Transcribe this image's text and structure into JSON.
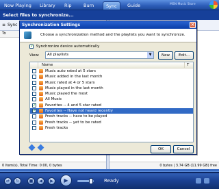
{
  "nav": {
    "tabs": [
      "Now Playing",
      "Library",
      "Rip",
      "Burn",
      "Sync",
      "Guide"
    ],
    "active_tab": "Sync",
    "brand": "MSN Music Store"
  },
  "page": {
    "header": "Select files to synchronize...",
    "left_toolbar_label": "Sync Li",
    "left_status": "0 Item(s), Total Time: 0:00, 0 bytes",
    "right_status": "0 bytes | 3.74 GB (11.99 GB) free"
  },
  "player": {
    "status": "Ready",
    "volume": 0.75
  },
  "dialog": {
    "title": "Synchronization Settings",
    "instruction": "Choose a synchronization method and the playlists you want to synchronize.",
    "auto_sync_label": "Synchronize device automatically",
    "auto_sync_checked": true,
    "view_label": "View:",
    "view_value": "All playlists",
    "new_button": "New",
    "edit_button": "Edit...",
    "column_name": "Name",
    "playlists": [
      {
        "name": "Music auto rated at 5 stars",
        "checked": false,
        "selected": false
      },
      {
        "name": "Music added in the last month",
        "checked": false,
        "selected": false
      },
      {
        "name": "Music rated at 4 or 5 stars",
        "checked": false,
        "selected": false
      },
      {
        "name": "Music played in the last month",
        "checked": false,
        "selected": false
      },
      {
        "name": "Music played the most",
        "checked": false,
        "selected": false
      },
      {
        "name": "All Music",
        "checked": false,
        "selected": false
      },
      {
        "name": "Favorites -- 4 and 5 star rated",
        "checked": true,
        "selected": false
      },
      {
        "name": "Favorites -- Have not heard recently",
        "checked": true,
        "selected": true
      },
      {
        "name": "Fresh tracks -- have to be played",
        "checked": false,
        "selected": false
      },
      {
        "name": "Fresh tracks -- yet to be rated",
        "checked": false,
        "selected": false
      },
      {
        "name": "Fresh tracks",
        "checked": false,
        "selected": false
      }
    ],
    "ok_button": "OK",
    "cancel_button": "Cancel"
  },
  "colors": {
    "accent": "#316ac5",
    "title_bar": "#0a3ea8",
    "app_blue": "#1e4fa0"
  }
}
